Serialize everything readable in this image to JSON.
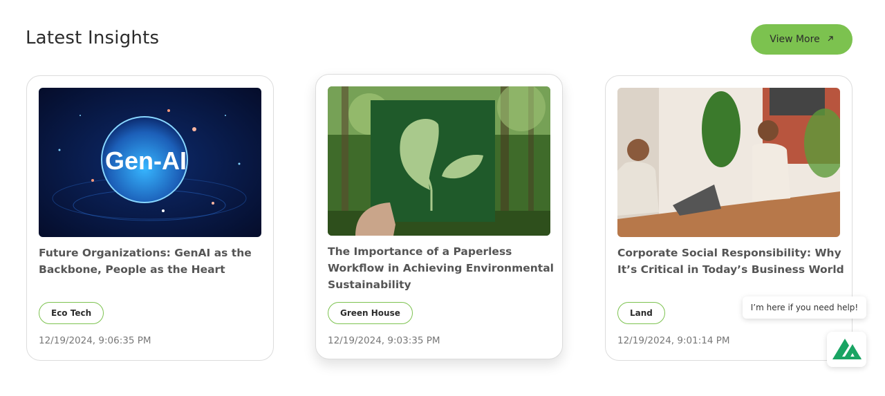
{
  "header": {
    "title": "Latest Insights",
    "view_more_label": "View More",
    "view_more_icon": "arrow-up-right-icon"
  },
  "cards": [
    {
      "image_text": "Gen-AI",
      "image_icon": "genai-globe-image",
      "title": "Future Organizations: GenAI as the Backbone, People as the Heart",
      "tag": "Eco Tech",
      "date": "12/19/2024, 9:06:35 PM"
    },
    {
      "image_icon": "paper-leaf-forest-image",
      "title": "The Importance of a Paperless Workflow in Achieving Environmental Sustainability",
      "tag": "Green House",
      "date": "12/19/2024, 9:03:35 PM"
    },
    {
      "image_icon": "office-meeting-image",
      "title": "Corporate Social Responsibility: Why It’s Critical in Today’s Business World",
      "tag": "Land",
      "date": "12/19/2024, 9:01:14 PM"
    }
  ],
  "chat": {
    "bubble_text": "I’m here if you need help!",
    "icon": "chat-logo-icon"
  },
  "colors": {
    "accent": "#7cc24f",
    "chat_logo": "#19a463"
  }
}
